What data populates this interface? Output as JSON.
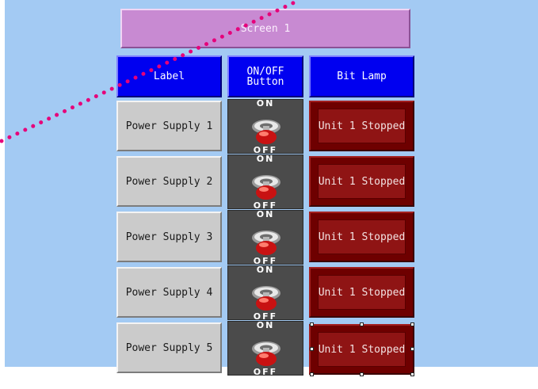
{
  "title": "Screen 1",
  "headers": {
    "label": "Label",
    "button_line1": "ON/OFF",
    "button_line2": "Button",
    "lamp": "Bit Lamp"
  },
  "switch": {
    "on_text": "ON",
    "off_text": "OFF"
  },
  "rows": [
    {
      "label": "Power Supply 1",
      "lamp": "Unit 1 Stopped"
    },
    {
      "label": "Power Supply 2",
      "lamp": "Unit 1 Stopped"
    },
    {
      "label": "Power Supply 3",
      "lamp": "Unit 1 Stopped"
    },
    {
      "label": "Power Supply 4",
      "lamp": "Unit 1 Stopped"
    },
    {
      "label": "Power Supply 5",
      "lamp": "Unit 1 Stopped"
    }
  ],
  "colors": {
    "screen_background": "#a3caf3",
    "title_bar": "#c88ad2",
    "header": "#0000f0",
    "label_cell": "#cbcbcb",
    "switch_background": "#4b4b4b",
    "lamp_off": "#6e0000",
    "drag_line": "#e6007a"
  }
}
